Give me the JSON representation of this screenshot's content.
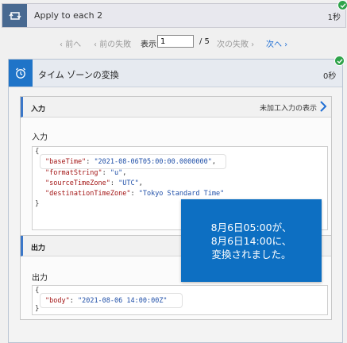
{
  "loop": {
    "title": "Apply to each 2",
    "duration": "1秒"
  },
  "pager": {
    "prev": "前へ",
    "prev_failed": "前の失敗",
    "show_label": "表示",
    "current": "1",
    "total": "/ 5",
    "next_failed": "次の失敗",
    "next": "次へ"
  },
  "action": {
    "title": "タイム ゾーンの変換",
    "duration": "0秒",
    "icon": "alarm-clock-icon"
  },
  "inputs": {
    "header": "入力",
    "raw_link": "未加工入力の表示",
    "label": "入力",
    "open_brace": "{",
    "close_brace": "}",
    "lines": [
      {
        "key": "\"baseTime\"",
        "sep": ": ",
        "value": "\"2021-08-06T05:00:00.0000000\"",
        "end": ","
      },
      {
        "key": "\"formatString\"",
        "sep": ": ",
        "value": "\"u\"",
        "end": ","
      },
      {
        "key": "\"sourceTimeZone\"",
        "sep": ": ",
        "value": "\"UTC\"",
        "end": ","
      },
      {
        "key": "\"destinationTimeZone\"",
        "sep": ": ",
        "value": "\"Tokyo Standard Time\"",
        "end": ""
      }
    ]
  },
  "outputs": {
    "header": "出力",
    "label": "出力",
    "open_brace": "{",
    "close_brace": "}",
    "lines": [
      {
        "key": "\"body\"",
        "sep": ": ",
        "value": "\"2021-08-06 14:00:00Z\"",
        "end": ""
      }
    ]
  },
  "callout": {
    "line1": "8月6日05:00が、",
    "line2": "8月6日14:00に、",
    "line3": "変換されました。"
  },
  "colors": {
    "accent": "#1f74c8",
    "loop_icon": "#486991",
    "success": "#2fa34a",
    "link": "#1f6ed4",
    "json_key": "#a31515",
    "json_value": "#1f4fa8",
    "callout_bg": "#0d6fc2"
  }
}
